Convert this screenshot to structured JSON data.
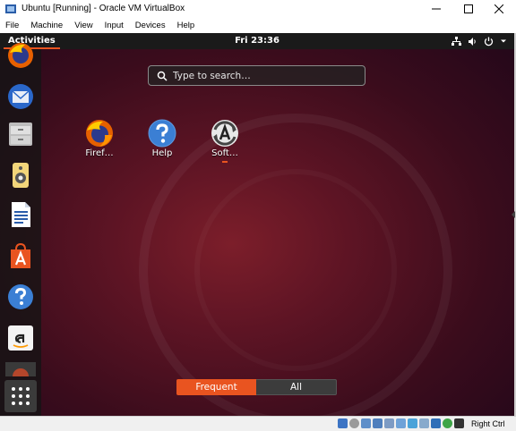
{
  "window": {
    "title": "Ubuntu [Running] - Oracle VM VirtualBox",
    "controls": [
      "minimize",
      "maximize",
      "close"
    ]
  },
  "menubar": {
    "items": [
      "File",
      "Machine",
      "View",
      "Input",
      "Devices",
      "Help"
    ]
  },
  "topbar": {
    "activities": "Activities",
    "clock": "Fri 23:36",
    "tray_icons": [
      "network-icon",
      "volume-icon",
      "power-icon",
      "dropdown-arrow-icon"
    ]
  },
  "search": {
    "placeholder": "Type to search…"
  },
  "dock": {
    "items": [
      "firefox-icon",
      "thunderbird-icon",
      "files-icon",
      "rhythmbox-icon",
      "libreoffice-writer-icon",
      "ubuntu-software-icon",
      "help-icon",
      "amazon-icon"
    ],
    "show_apps": "show-applications-icon"
  },
  "apps": [
    {
      "label": "Firef…",
      "icon": "firefox-icon"
    },
    {
      "label": "Help",
      "icon": "help-icon"
    },
    {
      "label": "Soft…",
      "icon": "software-updater-icon",
      "running": true
    }
  ],
  "view_switch": {
    "frequent": "Frequent",
    "all": "All",
    "selected": "Frequent"
  },
  "statusbar": {
    "host_key": "Right Ctrl"
  },
  "colors": {
    "accent": "#e95420",
    "topbar": "#1a1a1a",
    "background": "#5d1424"
  }
}
